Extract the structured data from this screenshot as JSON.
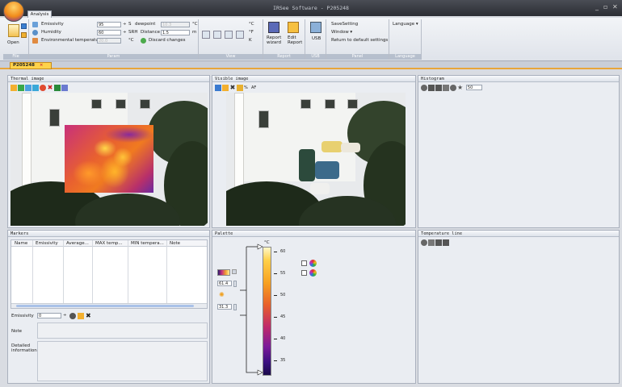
{
  "window": {
    "title": "IRSee Software - P205248",
    "min": "_",
    "max": "▫",
    "close": "✕"
  },
  "ribbon": {
    "tab": "Analysis",
    "file": {
      "open": "Open",
      "group": "File"
    },
    "param": {
      "emissivity_label": "Emissivity",
      "emissivity_value": "95",
      "humidity_label": "Humidity",
      "humidity_value": "60",
      "env_temp_label": "Environmental temperature",
      "env_temp_value": "20.0",
      "s_unit": "S",
      "dewpoint_label": "dewpoint",
      "dewpoint_value": "10.3",
      "dewpoint_unit": "°C",
      "srh_label": "SRH",
      "distance_label": "Distance",
      "distance_value": "1.5",
      "distance_unit": "m",
      "c_unit": "°C",
      "discard": "Discard changes",
      "group": "Param"
    },
    "view": {
      "group": "View",
      "units": [
        "°C",
        "°F",
        "K"
      ]
    },
    "report": {
      "wizard": "Report wizard",
      "edit": "Edit Report",
      "group": "Report"
    },
    "usb": {
      "label": "USB",
      "group": "USB"
    },
    "panel": {
      "savesetting": "SaveSetting",
      "window": "Window ▾",
      "return": "Return to default settings",
      "group": "Panel"
    },
    "language": {
      "label": "Language ▾",
      "group": "Language"
    }
  },
  "doc_tab": {
    "label": "P205248",
    "close": "×"
  },
  "thermal": {
    "title": "Thermal image"
  },
  "visible": {
    "title": "Visible image",
    "pct": "%",
    "af": "AF"
  },
  "histogram": {
    "title": "Histogram",
    "value": "50"
  },
  "markers": {
    "title": "Markers",
    "columns": [
      "Name",
      "Emissivity",
      "Average...",
      "MAX temp...",
      "MIN tempera...",
      "Note"
    ],
    "emissivity_label": "Emissivity",
    "emissivity_value": "0",
    "note_label": "Note",
    "detail_label": "Detailed information"
  },
  "palette": {
    "title": "Palette",
    "unit": "°C",
    "max_value": "61.4",
    "min_value": "31.3",
    "ticks": [
      "60",
      "55",
      "50",
      "45",
      "40",
      "35"
    ]
  },
  "temperature_line": {
    "title": "Temperature line"
  },
  "colors": {
    "accent": "#e8a53a",
    "tab": "#ffd24a",
    "ribbon_group": "#b6bfcd"
  }
}
